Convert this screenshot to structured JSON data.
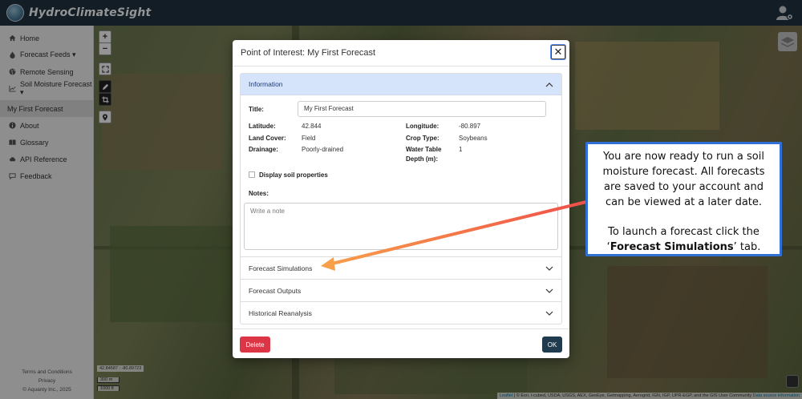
{
  "app": {
    "brand": "HydroClimateSight"
  },
  "sidebar": {
    "items": [
      {
        "label": "Home",
        "icon": "home-icon"
      },
      {
        "label": "Forecast Feeds ▾",
        "icon": "droplet-icon"
      },
      {
        "label": "Remote Sensing",
        "icon": "globe-icon"
      },
      {
        "label": "Soil Moisture Forecast ▾",
        "icon": "chart-icon"
      },
      {
        "label": "My First Forecast",
        "icon": ""
      },
      {
        "label": "About",
        "icon": "info-icon"
      },
      {
        "label": "Glossary",
        "icon": "book-icon"
      },
      {
        "label": "API Reference",
        "icon": "cloud-icon"
      },
      {
        "label": "Feedback",
        "icon": "comment-icon"
      }
    ],
    "footer": {
      "terms": "Terms and Conditions",
      "privacy": "Privacy",
      "copyright": "© Aquanty Inc., 2025"
    }
  },
  "map": {
    "zoom_in": "+",
    "zoom_out": "−",
    "coords": "42.84587 : -80.89723",
    "scale_m": "300 m",
    "scale_ft": "1000 ft",
    "attribution_prefix": "Leaflet",
    "attribution_text": " | © Esri, i-cubed, USDA, USGS, AEX, GeoEye, Getmapping, Aerogrid, IGN, IGP, UPR-EGP, and the GIS User Community",
    "attribution_link": "Data source information"
  },
  "modal": {
    "title": "Point of Interest: My First Forecast",
    "close": "✕",
    "information": {
      "header": "Information",
      "title_label": "Title:",
      "title_value": "My First Forecast",
      "latitude_label": "Latitude:",
      "latitude_value": "42.844",
      "longitude_label": "Longitude:",
      "longitude_value": "-80.897",
      "landcover_label": "Land Cover:",
      "landcover_value": "Field",
      "croptype_label": "Crop Type:",
      "croptype_value": "Soybeans",
      "drainage_label": "Drainage:",
      "drainage_value": "Poorly-drained",
      "watertable_label_1": "Water Table",
      "watertable_label_2": "Depth (m):",
      "watertable_value": "1",
      "soil_checkbox_label": "Display soil properties",
      "notes_label": "Notes:",
      "notes_placeholder": "Write a note"
    },
    "sections": [
      {
        "label": "Forecast Simulations"
      },
      {
        "label": "Forecast Outputs"
      },
      {
        "label": "Historical Reanalysis"
      }
    ],
    "delete_label": "Delete",
    "ok_label": "OK"
  },
  "callout": {
    "line1": "You are now ready to run a soil moisture forecast. All forecasts are saved to your account and can be viewed at a later date.",
    "line2_prefix": "To launch a forecast click the ‘",
    "line2_bold": "Forecast Simulations",
    "line2_suffix": "’ tab."
  },
  "colors": {
    "topbar": "#1f3340",
    "accordion_open": "#d6e4fb",
    "delete": "#dc3545",
    "ok": "#1f3b4d",
    "callout_border": "#2f6fd6",
    "arrow": "#f26a4b"
  }
}
